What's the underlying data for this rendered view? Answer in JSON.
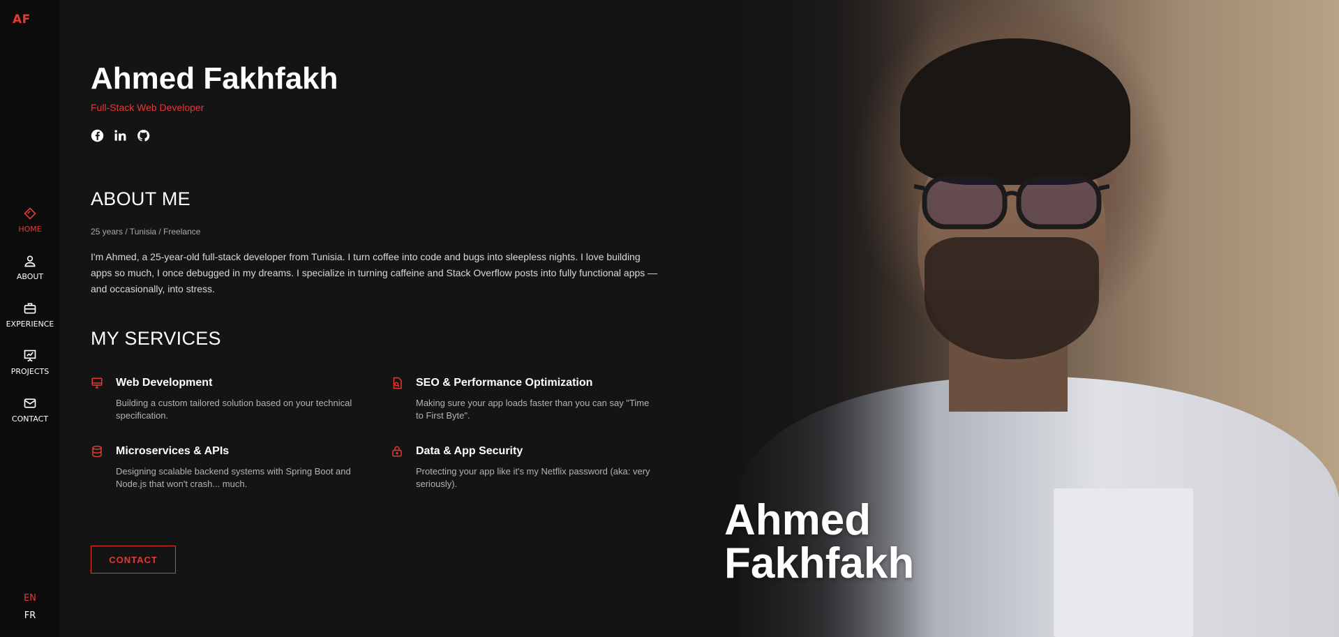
{
  "brand": {
    "logo": "AF",
    "accent": "#e53935"
  },
  "sidebar": {
    "items": [
      {
        "label": "HOME",
        "icon": "home-icon",
        "active": true
      },
      {
        "label": "ABOUT",
        "icon": "user-icon",
        "active": false
      },
      {
        "label": "EXPERIENCE",
        "icon": "briefcase-icon",
        "active": false
      },
      {
        "label": "PROJECTS",
        "icon": "presentation-chart-icon",
        "active": false
      },
      {
        "label": "CONTACT",
        "icon": "mail-icon",
        "active": false
      }
    ],
    "languages": [
      {
        "label": "EN",
        "active": true
      },
      {
        "label": "FR",
        "active": false
      }
    ]
  },
  "hero": {
    "name": "Ahmed Fakhfakh",
    "role": "Full-Stack Web Developer",
    "socials": [
      "facebook-icon",
      "linkedin-icon",
      "github-icon"
    ],
    "photo_caption_line1": "Ahmed",
    "photo_caption_line2": "Fakhfakh"
  },
  "about": {
    "title": "ABOUT ME",
    "meta": "25 years / Tunisia / Freelance",
    "text": "I'm Ahmed, a 25-year-old full-stack developer from Tunisia. I turn coffee into code and bugs into sleepless nights. I love building apps so much, I once debugged in my dreams. I specialize in turning caffeine and Stack Overflow posts into fully functional apps — and occasionally, into stress."
  },
  "services": {
    "title": "MY SERVICES",
    "items": [
      {
        "title": "Web Development",
        "desc": "Building a custom tailored solution based on your technical specification.",
        "icon": "monitor-icon"
      },
      {
        "title": "SEO & Performance Optimization",
        "desc": "Making sure your app loads faster than you can say \"Time to First Byte\".",
        "icon": "seo-search-icon"
      },
      {
        "title": "Microservices & APIs",
        "desc": "Designing scalable backend systems with Spring Boot and Node.js that won't crash... much.",
        "icon": "database-icon"
      },
      {
        "title": "Data & App Security",
        "desc": "Protecting your app like it's my Netflix password (aka: very seriously).",
        "icon": "lock-icon"
      }
    ]
  },
  "cta": {
    "label": "CONTACT"
  }
}
